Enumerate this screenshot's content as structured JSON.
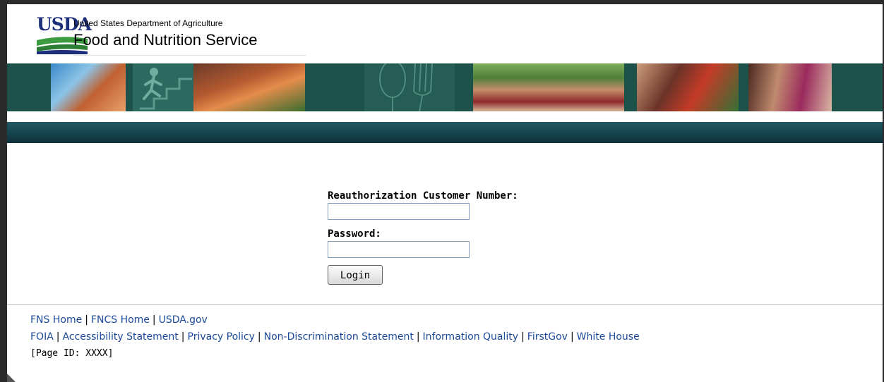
{
  "header": {
    "logo_text": "USDA",
    "agency_line": "United States Department of Agriculture",
    "service_line": "Food and Nutrition Service"
  },
  "banner": {
    "images": [
      "kids-basketball-photo",
      "exercise-stairs-icon",
      "kids-playing-photo",
      "fork-spoon-icon",
      "family-picnic-photo",
      "family-grocery-photo",
      "mother-daughter-computer-photo"
    ]
  },
  "login": {
    "customer_number_label": "Reauthorization Customer Number:",
    "customer_number_value": "",
    "password_label": "Password:",
    "password_value": "",
    "login_button": "Login"
  },
  "footer": {
    "row1": [
      "FNS Home",
      "FNCS Home",
      "USDA.gov"
    ],
    "row2": [
      "FOIA",
      "Accessibility Statement",
      "Privacy Policy",
      "Non-Discrimination Statement",
      "Information Quality",
      "FirstGov",
      "White House"
    ],
    "page_id": "[Page ID: XXXX]"
  },
  "colors": {
    "banner": "#1c5249",
    "bar": "#15424c",
    "link": "#1b4a9a",
    "usda_blue": "#1b2f7a",
    "usda_green": "#3c9a3f"
  }
}
